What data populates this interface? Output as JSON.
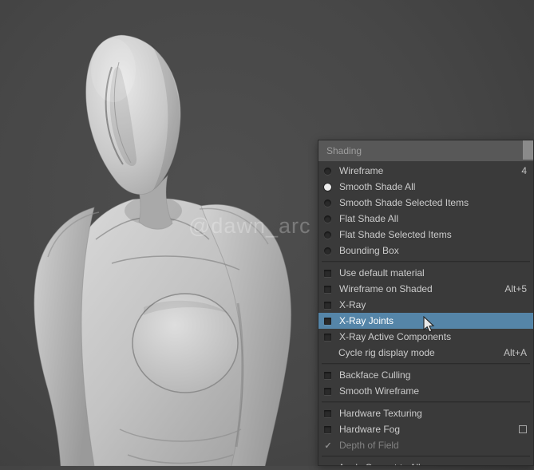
{
  "viewport": {
    "watermark": "@dawn_arc",
    "model": "grey-clay humanoid figure with helmet head"
  },
  "menu": {
    "title": "Shading",
    "highlight_color": "#5585a8",
    "sections": [
      {
        "items": [
          {
            "type": "radio",
            "label": "Wireframe",
            "checked": false,
            "shortcut": "4"
          },
          {
            "type": "radio",
            "label": "Smooth Shade All",
            "checked": true
          },
          {
            "type": "radio",
            "label": "Smooth Shade Selected Items",
            "checked": false
          },
          {
            "type": "radio",
            "label": "Flat Shade All",
            "checked": false
          },
          {
            "type": "radio",
            "label": "Flat Shade Selected Items",
            "checked": false
          },
          {
            "type": "radio",
            "label": "Bounding Box",
            "checked": false
          }
        ]
      },
      {
        "items": [
          {
            "type": "checkbox",
            "label": "Use default material",
            "checked": false
          },
          {
            "type": "checkbox",
            "label": "Wireframe on Shaded",
            "checked": false,
            "shortcut": "Alt+5"
          },
          {
            "type": "checkbox",
            "label": "X-Ray",
            "checked": false
          },
          {
            "type": "checkbox",
            "label": "X-Ray Joints",
            "checked": false,
            "highlighted": true
          },
          {
            "type": "checkbox",
            "label": "X-Ray Active Components",
            "checked": false
          },
          {
            "type": "command",
            "label": "Cycle rig display mode",
            "shortcut": "Alt+A"
          }
        ]
      },
      {
        "items": [
          {
            "type": "checkbox",
            "label": "Backface Culling",
            "checked": false
          },
          {
            "type": "checkbox",
            "label": "Smooth Wireframe",
            "checked": false
          }
        ]
      },
      {
        "items": [
          {
            "type": "checkbox",
            "label": "Hardware Texturing",
            "checked": false
          },
          {
            "type": "checkbox",
            "label": "Hardware Fog",
            "checked": false,
            "option_box": true
          },
          {
            "type": "checkbox",
            "label": "Depth of Field",
            "checked": true,
            "disabled": true
          }
        ]
      },
      {
        "items": [
          {
            "type": "command",
            "label": "Apply Current to All"
          }
        ]
      }
    ]
  }
}
